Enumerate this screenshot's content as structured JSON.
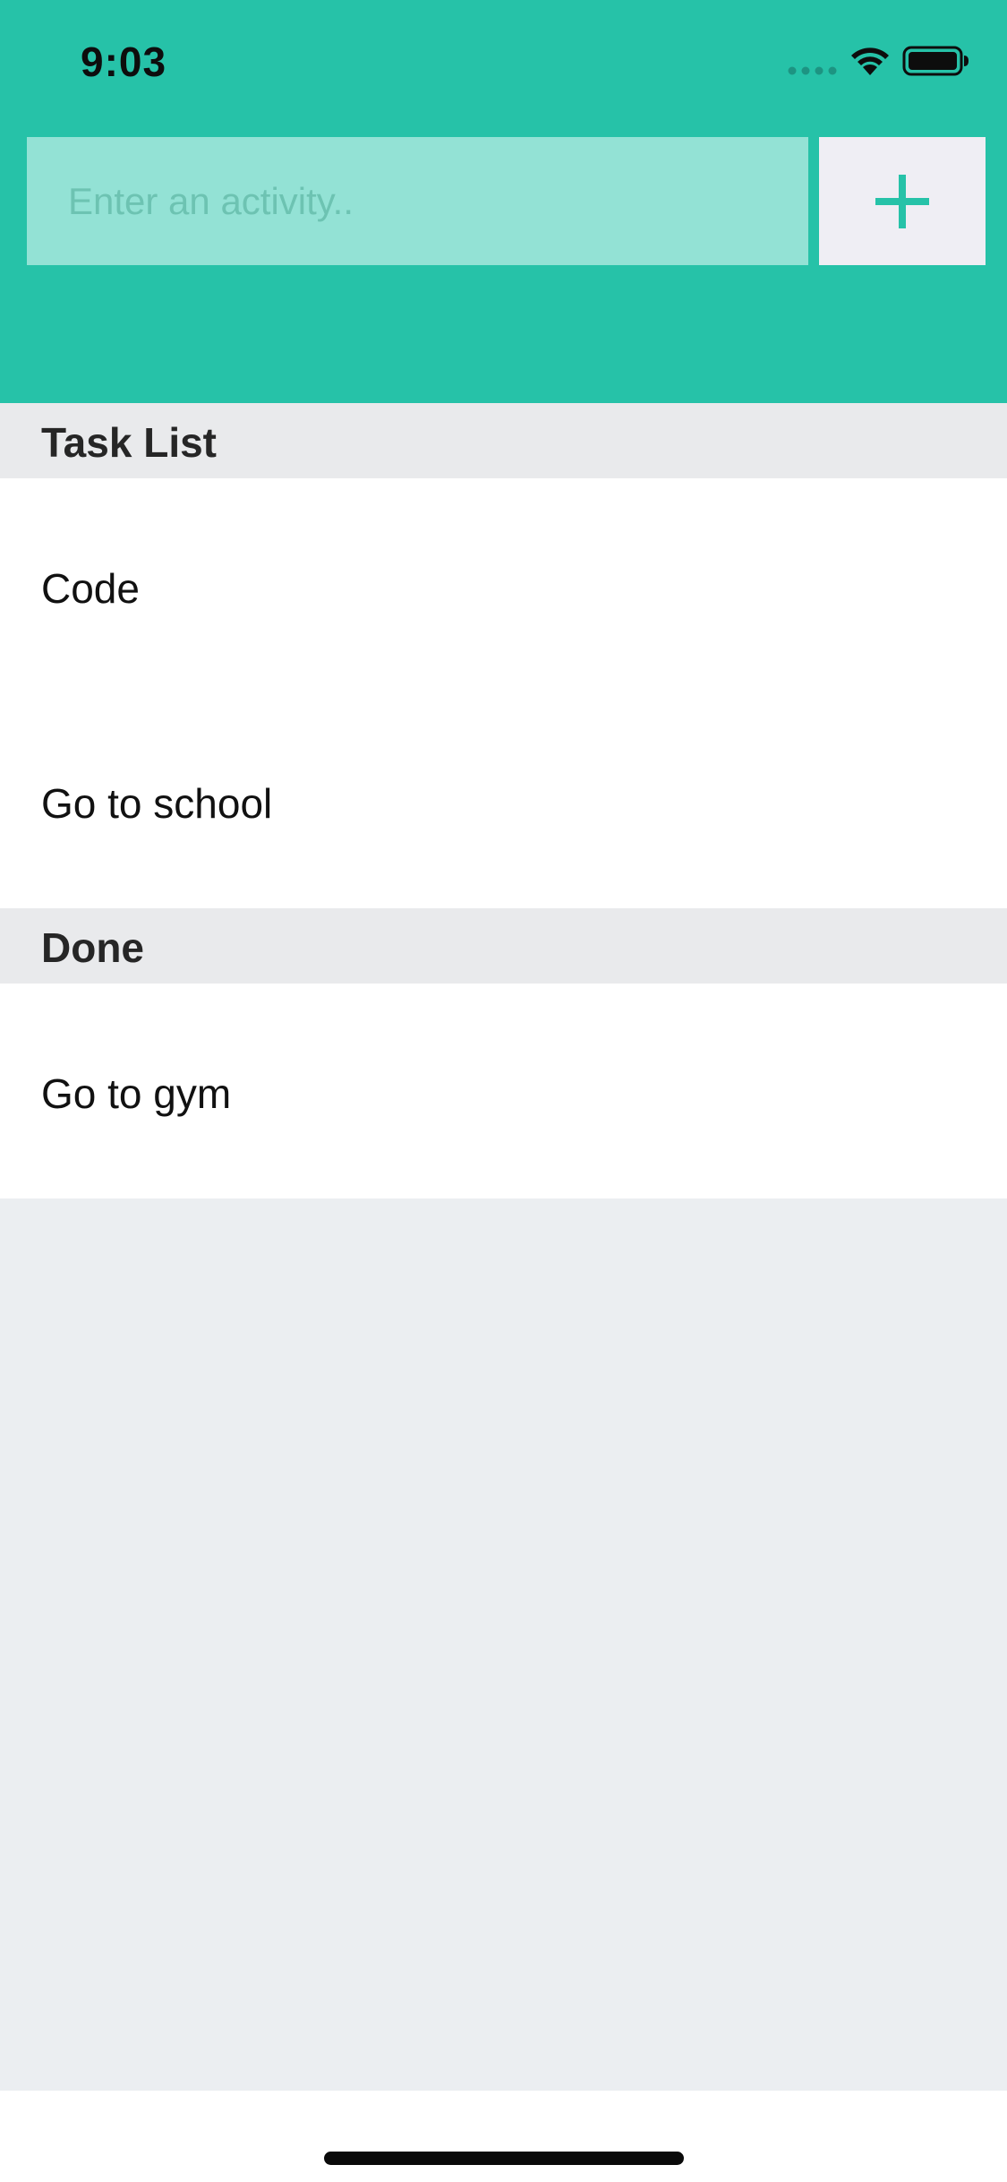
{
  "status_bar": {
    "time": "9:03",
    "icons": [
      "signal-dots-icon",
      "wifi-icon",
      "battery-icon"
    ]
  },
  "header": {
    "background_color": "#26c2a8",
    "input": {
      "value": "",
      "placeholder": "Enter an activity.."
    },
    "add_button": {
      "icon": "plus-icon",
      "icon_color": "#26c2a8"
    }
  },
  "sections": [
    {
      "title": "Task List",
      "items": [
        {
          "label": "Code"
        },
        {
          "label": "Go to school"
        }
      ]
    },
    {
      "title": "Done",
      "items": [
        {
          "label": "Go to gym"
        }
      ]
    }
  ]
}
